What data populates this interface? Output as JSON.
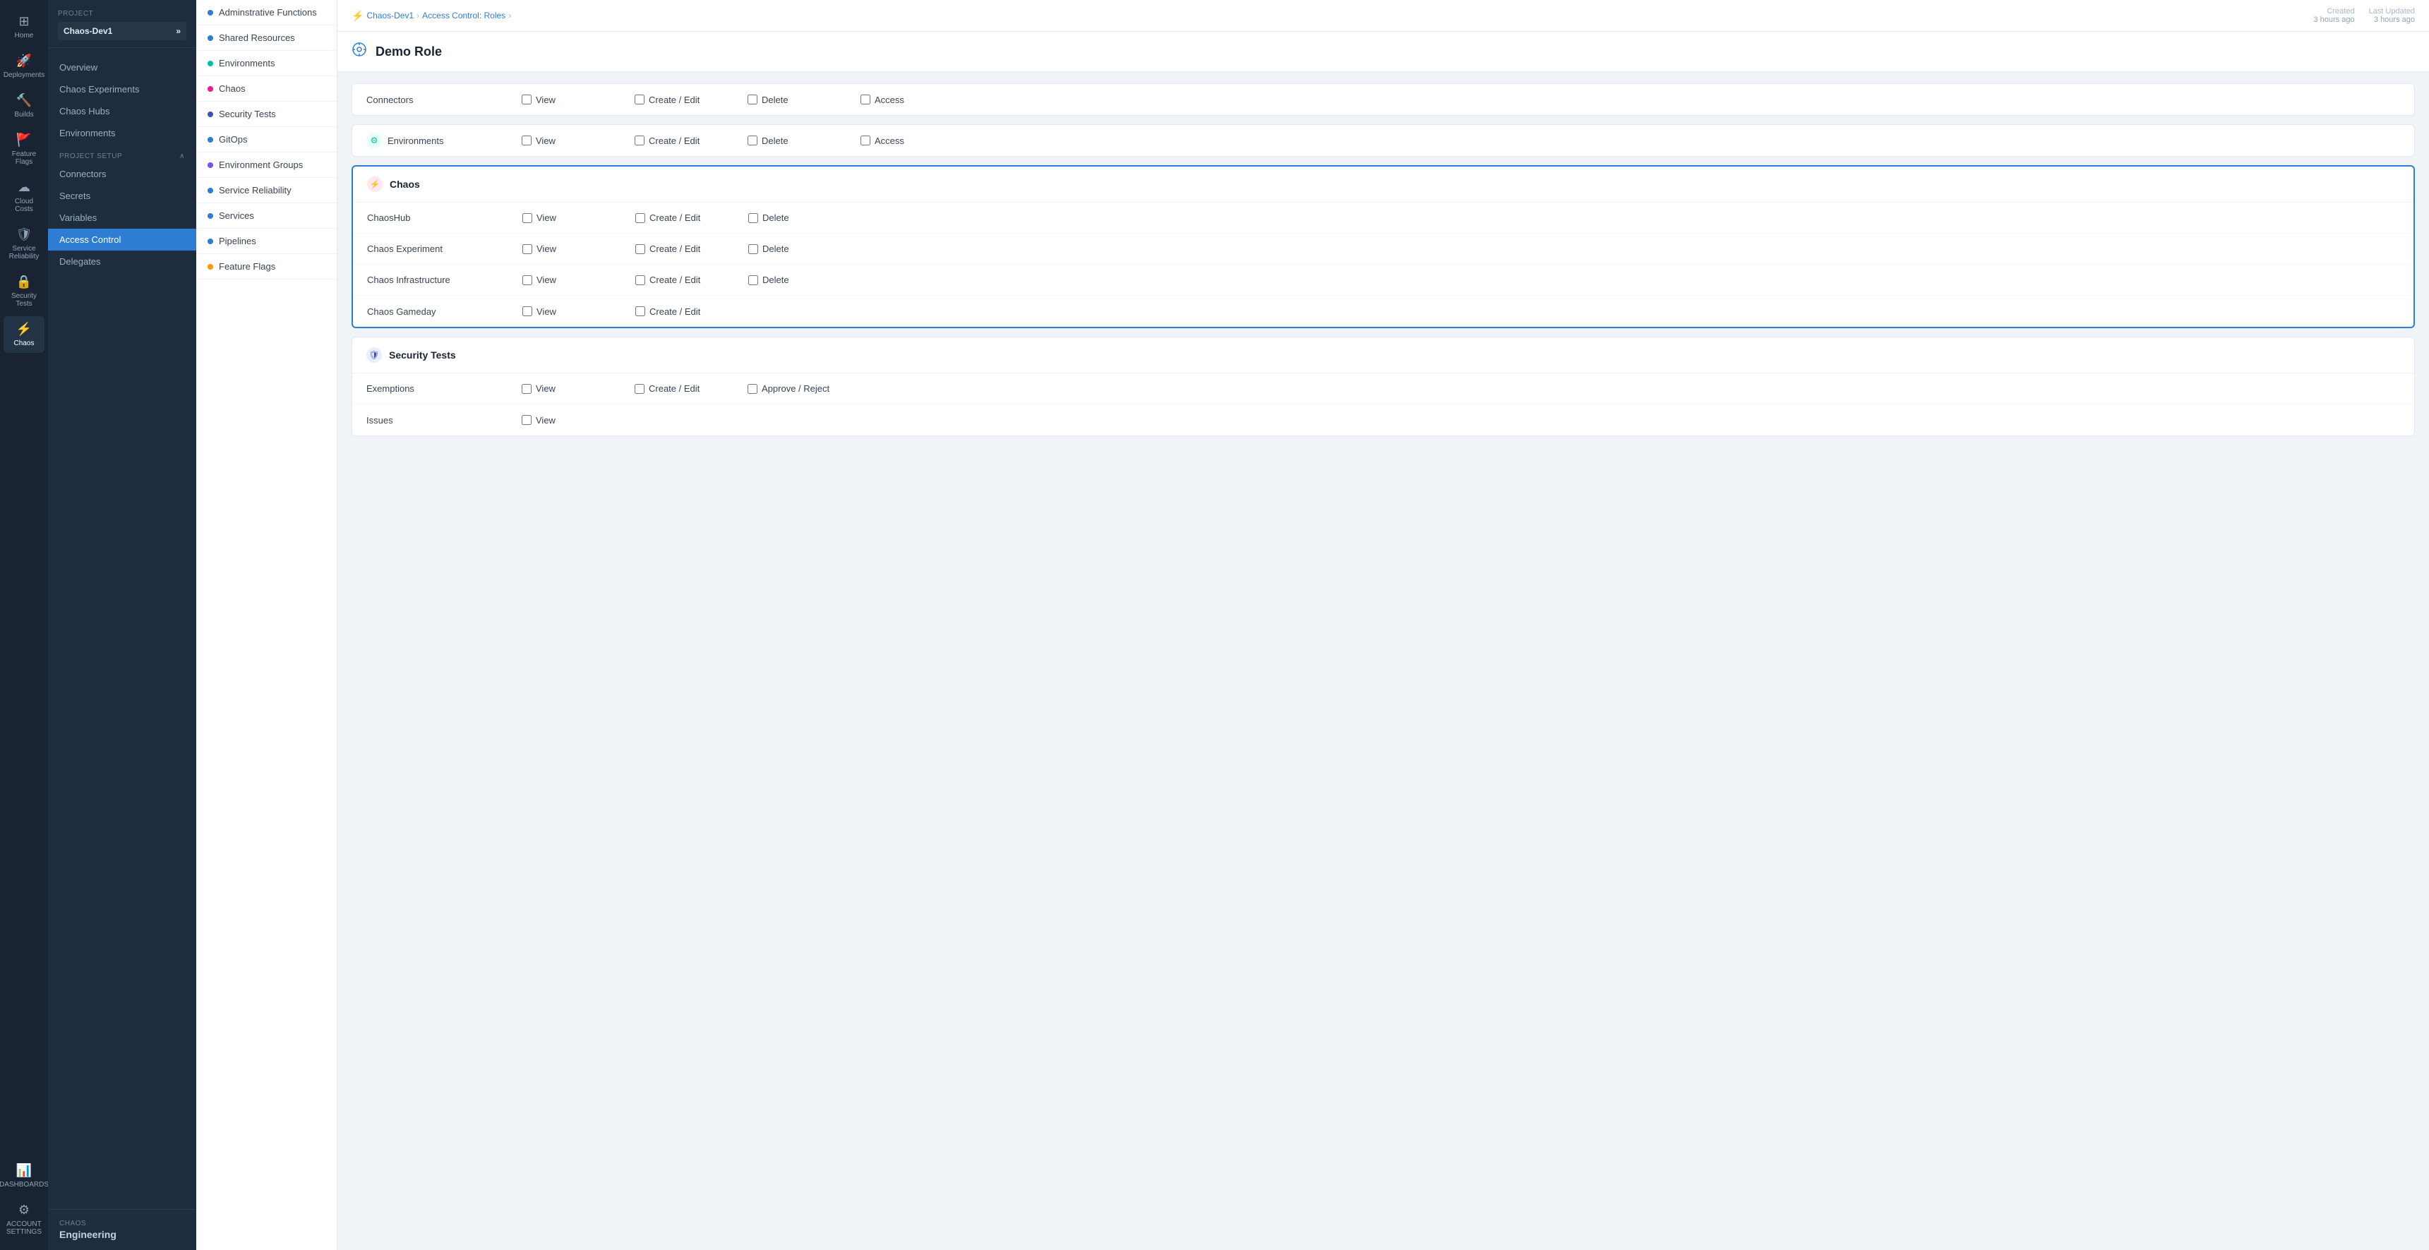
{
  "app": {
    "title": "CHAOS Engineering"
  },
  "icon_nav": {
    "items": [
      {
        "id": "home",
        "label": "Home",
        "icon": "⊞",
        "active": false
      },
      {
        "id": "deployments",
        "label": "Deployments",
        "icon": "🚀",
        "active": false
      },
      {
        "id": "builds",
        "label": "Builds",
        "icon": "🔧",
        "active": false
      },
      {
        "id": "feature-flags",
        "label": "Feature Flags",
        "icon": "🚩",
        "active": false
      },
      {
        "id": "cloud-costs",
        "label": "Cloud Costs",
        "icon": "☁",
        "active": false
      },
      {
        "id": "service-reliability",
        "label": "Service Reliability",
        "icon": "🛡",
        "active": false
      },
      {
        "id": "security-tests",
        "label": "Security Tests",
        "icon": "🔒",
        "active": false
      },
      {
        "id": "chaos",
        "label": "Chaos",
        "icon": "⚡",
        "active": true
      },
      {
        "id": "dashboards",
        "label": "DASHBOARDS",
        "icon": "📊",
        "active": false
      },
      {
        "id": "account-settings",
        "label": "ACCOUNT SETTINGS",
        "icon": "⚙",
        "active": false
      }
    ]
  },
  "sidebar": {
    "project_label": "Project",
    "project_name": "Chaos-Dev1",
    "nav_items": [
      {
        "id": "overview",
        "label": "Overview",
        "active": false
      },
      {
        "id": "chaos-experiments",
        "label": "Chaos Experiments",
        "active": false
      },
      {
        "id": "chaos-hubs",
        "label": "Chaos Hubs",
        "active": false
      },
      {
        "id": "environments",
        "label": "Environments",
        "active": false
      }
    ],
    "section_label": "PROJECT SETUP",
    "setup_items": [
      {
        "id": "connectors",
        "label": "Connectors",
        "active": false
      },
      {
        "id": "secrets",
        "label": "Secrets",
        "active": false
      },
      {
        "id": "variables",
        "label": "Variables",
        "active": false
      },
      {
        "id": "access-control",
        "label": "Access Control",
        "active": true
      },
      {
        "id": "delegates",
        "label": "Delegates",
        "active": false
      }
    ],
    "footer_label": "CHAOS",
    "footer_name": "Engineering"
  },
  "mid_panel": {
    "items": [
      {
        "id": "administrative",
        "label": "Adminstrative Functions",
        "dot_color": "#2d7dd2"
      },
      {
        "id": "shared-resources",
        "label": "Shared Resources",
        "dot_color": "#2d7dd2"
      },
      {
        "id": "environments",
        "label": "Environments",
        "dot_color": "#00bfa5"
      },
      {
        "id": "chaos",
        "label": "Chaos",
        "dot_color": "#e91e8c"
      },
      {
        "id": "security-tests",
        "label": "Security Tests",
        "dot_color": "#3f51b5"
      },
      {
        "id": "gitops",
        "label": "GitOps",
        "dot_color": "#2d7dd2"
      },
      {
        "id": "environment-groups",
        "label": "Environment Groups",
        "dot_color": "#7c4dff"
      },
      {
        "id": "service-reliability",
        "label": "Service Reliability",
        "dot_color": "#2d7dd2"
      },
      {
        "id": "services",
        "label": "Services",
        "dot_color": "#2d7dd2"
      },
      {
        "id": "pipelines",
        "label": "Pipelines",
        "dot_color": "#2d7dd2"
      },
      {
        "id": "feature-flags",
        "label": "Feature Flags",
        "dot_color": "#ff9800"
      }
    ]
  },
  "breadcrumb": {
    "project": "Chaos-Dev1",
    "section": "Access Control: Roles",
    "current": ""
  },
  "page_meta": {
    "created_label": "Created",
    "created_value": "3 hours ago",
    "updated_label": "Last Updated",
    "updated_value": "3 hours ago"
  },
  "page_title": "Demo Role",
  "permission_sections": [
    {
      "id": "connectors",
      "title": "Connectors",
      "icon": "🔗",
      "icon_class": "icon-blue",
      "is_header_only": false,
      "standalone_row": true,
      "rows": [
        {
          "label": "Connectors",
          "permissions": [
            "View",
            "Create / Edit",
            "Delete",
            "Access"
          ]
        }
      ]
    },
    {
      "id": "environments",
      "title": "Environments",
      "icon": "⚙",
      "icon_class": "icon-teal",
      "standalone_row": true,
      "rows": [
        {
          "label": "Environments",
          "permissions": [
            "View",
            "Create / Edit",
            "Delete",
            "Access"
          ]
        }
      ]
    },
    {
      "id": "chaos",
      "title": "Chaos",
      "icon": "⚡",
      "icon_class": "icon-pink",
      "active": true,
      "rows": [
        {
          "label": "ChaosHub",
          "permissions": [
            "View",
            "Create / Edit",
            "Delete"
          ]
        },
        {
          "label": "Chaos Experiment",
          "permissions": [
            "View",
            "Create / Edit",
            "Delete"
          ]
        },
        {
          "label": "Chaos Infrastructure",
          "permissions": [
            "View",
            "Create / Edit",
            "Delete"
          ]
        },
        {
          "label": "Chaos Gameday",
          "permissions": [
            "View",
            "Create / Edit"
          ]
        }
      ]
    },
    {
      "id": "security-tests",
      "title": "Security Tests",
      "icon": "🛡",
      "icon_class": "icon-darkblue",
      "rows": [
        {
          "label": "Exemptions",
          "permissions": [
            "View",
            "Create / Edit",
            "Approve / Reject"
          ]
        },
        {
          "label": "Issues",
          "permissions": [
            "View"
          ]
        }
      ]
    }
  ]
}
